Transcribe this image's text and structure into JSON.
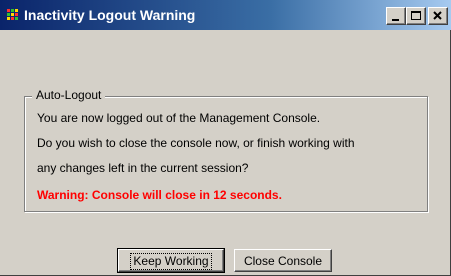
{
  "window": {
    "title": "Inactivity Logout Warning",
    "icon": "app-icon",
    "controls": [
      "minimize-icon",
      "maximize-icon",
      "close-icon"
    ]
  },
  "group": {
    "legend": "Auto-Logout",
    "lines": [
      "You are now logged out of the Management Console.",
      "Do you wish to close the console now, or finish working with",
      "any changes left in the current session?"
    ],
    "warning": "Warning: Console will close in 12 seconds."
  },
  "buttons": {
    "keep_working": "Keep Working",
    "close_console": "Close Console"
  },
  "colors": {
    "warning": "#ff0000",
    "title_gradient_start": "#0a246a",
    "title_gradient_end": "#a6caf0",
    "face": "#d4d0c8"
  }
}
